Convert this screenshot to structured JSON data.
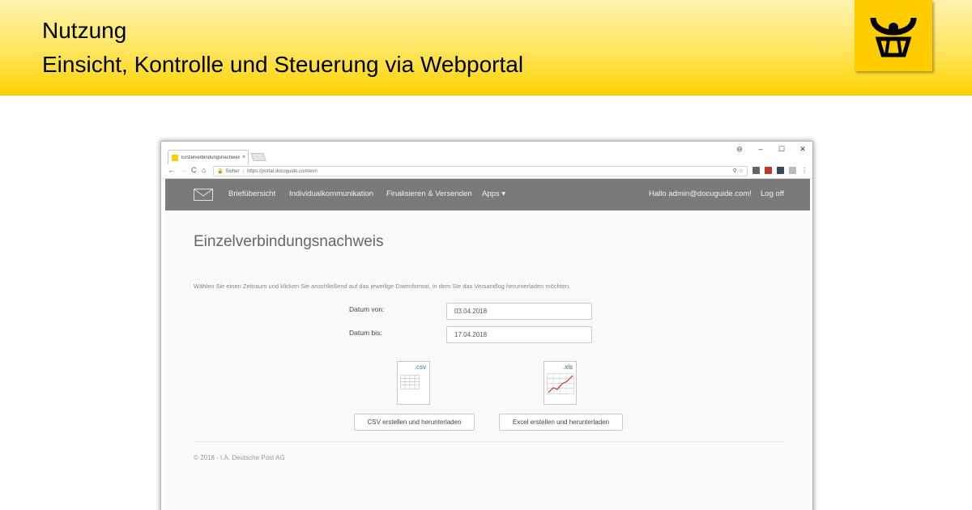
{
  "slide": {
    "title_line1": "Nutzung",
    "title_line2": "Einsicht, Kontrolle und Steuerung via Webportal",
    "logo_icon": "deutsche-post-horn-logo"
  },
  "browser": {
    "tab_title": "Einzelverbindungsnachweis",
    "tab_close": "×",
    "window_controls": [
      "⊖",
      "–",
      "☐",
      "✕"
    ],
    "nav_back": "←",
    "nav_forward": "→",
    "nav_reload": "C",
    "nav_home": "⌂",
    "secure_label": "Sicher",
    "url": "https://portal.docuguide.com/evn"
  },
  "navbar": {
    "items": [
      "Briefübersicht",
      "Individualkommunikation",
      "Finalisieren & Versenden",
      "Apps ▾"
    ],
    "greeting": "Hallo admin@docuguide.com!",
    "logoff": "Log off"
  },
  "main": {
    "title": "Einzelverbindungsnachweis",
    "intro": "Wählen Sie einen Zeitraum und klicken Sie anschließend auf das jeweilige Datenformat, in dem Sie das Versandlog herunterladen möchten.",
    "date_from_label": "Datum von:",
    "date_from_value": "03.04.2018",
    "date_to_label": "Datum bis:",
    "date_to_value": "17.04.2018",
    "csv_ext": ".csv",
    "xls_ext": ".xls",
    "csv_button": "CSV erstellen und herunterladen",
    "xls_button": "Excel erstellen und herunterladen",
    "footer": "© 2018 - I.A. Deutsche Post AG"
  },
  "colors": {
    "brand_yellow": "#ffcc00",
    "navbar_gray": "#7a7a7a"
  }
}
